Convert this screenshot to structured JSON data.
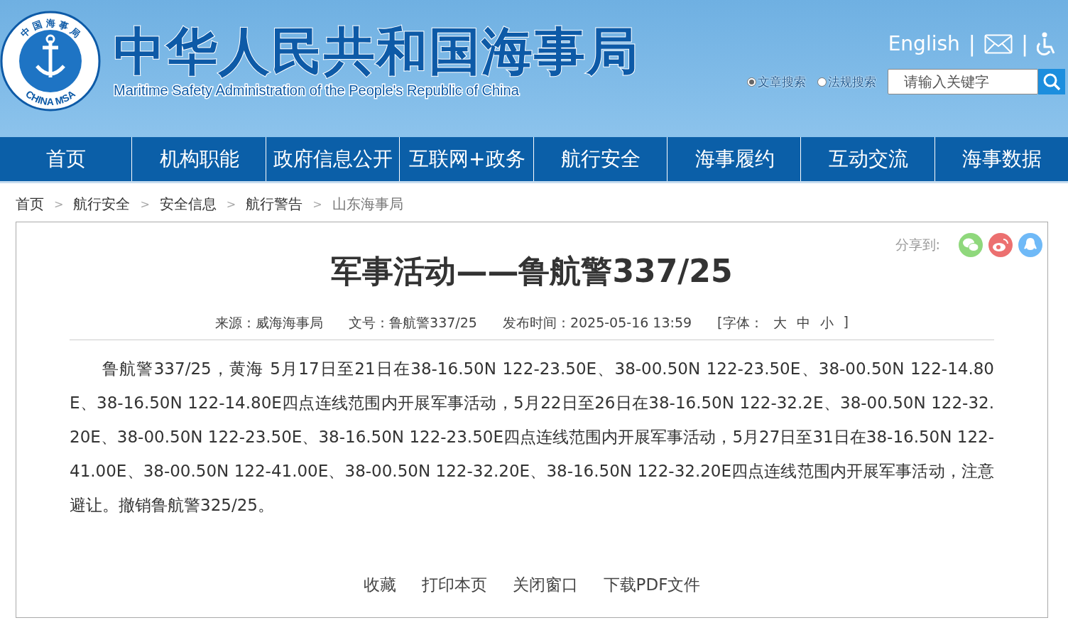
{
  "header": {
    "logo": {
      "ring_top": "中 国 海 事 局",
      "ring_bottom": "CHINA MSA"
    },
    "title": "中华人民共和国海事局",
    "subtitle": "Maritime Safety Administration of the People's Republic of China",
    "language_link": "English",
    "divider_1": "|",
    "divider_2": "|",
    "search": {
      "options": [
        {
          "label": "文章搜索",
          "selected": true
        },
        {
          "label": "法规搜索",
          "selected": false
        }
      ],
      "placeholder": "请输入关键字"
    }
  },
  "nav": [
    "首页",
    "机构职能",
    "政府信息公开",
    "互联网+政务",
    "航行安全",
    "海事履约",
    "互动交流",
    "海事数据"
  ],
  "breadcrumb": [
    {
      "kind": "link",
      "text": "首页"
    },
    {
      "kind": "separator",
      "text": ">"
    },
    {
      "kind": "link",
      "text": "航行安全"
    },
    {
      "kind": "separator",
      "text": ">"
    },
    {
      "kind": "link",
      "text": "安全信息"
    },
    {
      "kind": "separator",
      "text": ">"
    },
    {
      "kind": "link",
      "text": "航行警告"
    },
    {
      "kind": "separator",
      "text": ">"
    },
    {
      "kind": "current",
      "text": "山东海事局"
    }
  ],
  "article": {
    "share_label": "分享到:",
    "title": "军事活动——鲁航警337/25",
    "meta": [
      "来源：威海海事局",
      "文号：鲁航警337/25",
      "发布时间：2025-05-16 13:59"
    ],
    "font_size": {
      "prefix": "[字体：",
      "sizes": [
        "大",
        "中",
        "小"
      ],
      "suffix": "]"
    },
    "body": "鲁航警337/25，黄海 5月17日至21日在38-16.50N 122-23.50E、38-00.50N 122-23.50E、38-00.50N 122-14.80E、38-16.50N 122-14.80E四点连线范围内开展军事活动，5月22日至26日在38-16.50N 122-32.2E、38-00.50N 122-32.20E、38-00.50N 122-23.50E、38-16.50N 122-23.50E四点连线范围内开展军事活动，5月27日至31日在38-16.50N 122-41.00E、38-00.50N 122-41.00E、38-00.50N 122-32.20E、38-16.50N 122-32.20E四点连线范围内开展军事活动，注意避让。撤销鲁航警325/25。",
    "actions": [
      "收藏",
      "打印本页",
      "关闭窗口",
      "下载PDF文件"
    ]
  }
}
